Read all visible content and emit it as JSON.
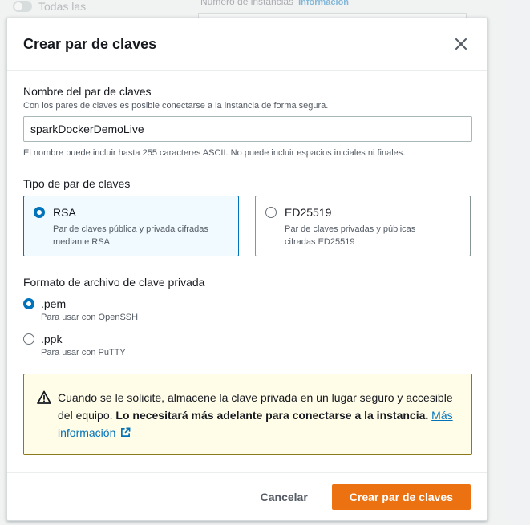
{
  "background": {
    "toggle_label": "Todas las",
    "field_label": "Número de instancias",
    "field_info": "Información"
  },
  "modal": {
    "title": "Crear par de claves",
    "name_field": {
      "label": "Nombre del par de claves",
      "description": "Con los pares de claves es posible conectarse a la instancia de forma segura.",
      "value": "sparkDockerDemoLive",
      "hint": "El nombre puede incluir hasta 255 caracteres ASCII. No puede incluir espacios iniciales ni finales."
    },
    "key_type": {
      "label": "Tipo de par de claves",
      "options": [
        {
          "title": "RSA",
          "desc_line1": "Par de claves pública y privada cifradas",
          "desc_line2": "mediante RSA",
          "selected": true
        },
        {
          "title": "ED25519",
          "desc_line1": "Par de claves privadas y públicas",
          "desc_line2": "cifradas ED25519",
          "selected": false
        }
      ]
    },
    "file_format": {
      "label": "Formato de archivo de clave privada",
      "options": [
        {
          "title": ".pem",
          "desc": "Para usar con OpenSSH",
          "selected": true
        },
        {
          "title": ".ppk",
          "desc": "Para usar con PuTTY",
          "selected": false
        }
      ]
    },
    "alert": {
      "text_plain": "Cuando se le solicite, almacene la clave privada en un lugar seguro y accesible del equipo.",
      "text_bold": "Lo necesitará más adelante para conectarse a la instancia.",
      "link_text": "Más información"
    },
    "footer": {
      "cancel_label": "Cancelar",
      "create_label": "Crear par de claves"
    }
  },
  "colors": {
    "accent": "#0073bb",
    "primary_button": "#ec7211",
    "warning_bg": "#fffce8",
    "warning_border": "#8b7a1b"
  }
}
